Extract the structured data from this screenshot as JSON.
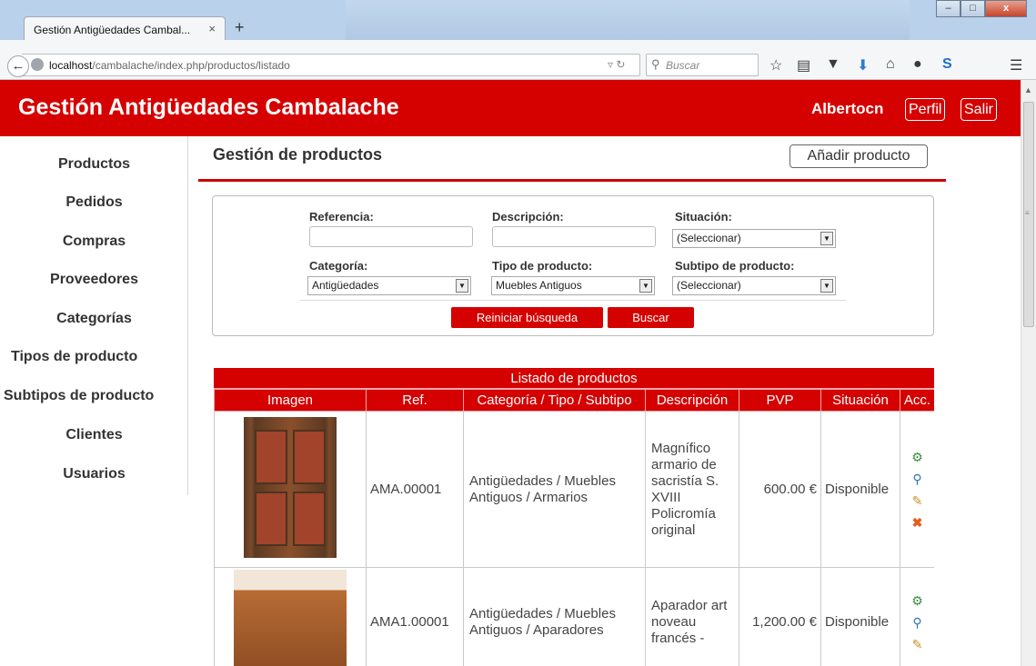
{
  "browser": {
    "tab_title": "Gestión Antigüedades Cambal...",
    "tab_close": "×",
    "new_tab": "+",
    "url_host": "localhost",
    "url_path": "/cambalache/index.php/productos/listado",
    "search_placeholder": "Buscar",
    "window_buttons": [
      "–",
      "□",
      "x"
    ]
  },
  "header": {
    "title": "Gestión Antigüedades Cambalache",
    "user": "Albertocn",
    "profile_label": "Perfil",
    "logout_label": "Salir"
  },
  "sidebar": {
    "items": [
      "Productos",
      "Pedidos",
      "Compras",
      "Proveedores",
      "Categorías",
      "Tipos de producto",
      "Subtipos de producto",
      "Clientes",
      "Usuarios"
    ]
  },
  "main": {
    "title": "Gestión de productos",
    "add_label": "Añadir producto"
  },
  "filters": {
    "referencia_label": "Referencia:",
    "descripcion_label": "Descripción:",
    "situacion_label": "Situación:",
    "situacion_value": "(Seleccionar)",
    "categoria_label": "Categoría:",
    "categoria_value": "Antigüedades",
    "tipo_label": "Tipo de producto:",
    "tipo_value": "Muebles Antiguos",
    "subtipo_label": "Subtipo de producto:",
    "subtipo_value": "(Seleccionar)",
    "reset_label": "Reiniciar búsqueda",
    "search_label": "Buscar"
  },
  "table": {
    "caption": "Listado de productos",
    "headers": [
      "Imagen",
      "Ref.",
      "Categoría / Tipo / Subtipo",
      "Descripción",
      "PVP",
      "Situación",
      "Acc."
    ],
    "rows": [
      {
        "ref": "AMA.00001",
        "categoria": "Antigüedades  /  Muebles Antiguos  /  Armarios",
        "descripcion": "Magnífico armario de sacristía S. XVIII Policromía original",
        "pvp": "600.00 €",
        "situacion": "Disponible"
      },
      {
        "ref": "AMA1.00001",
        "categoria": "Antigüedades  /  Muebles Antiguos  /  Aparadores",
        "descripcion": "Aparador art noveau francés -",
        "pvp": "1,200.00 €",
        "situacion": "Disponible"
      }
    ]
  },
  "colors": {
    "brand_red": "#d50000"
  }
}
